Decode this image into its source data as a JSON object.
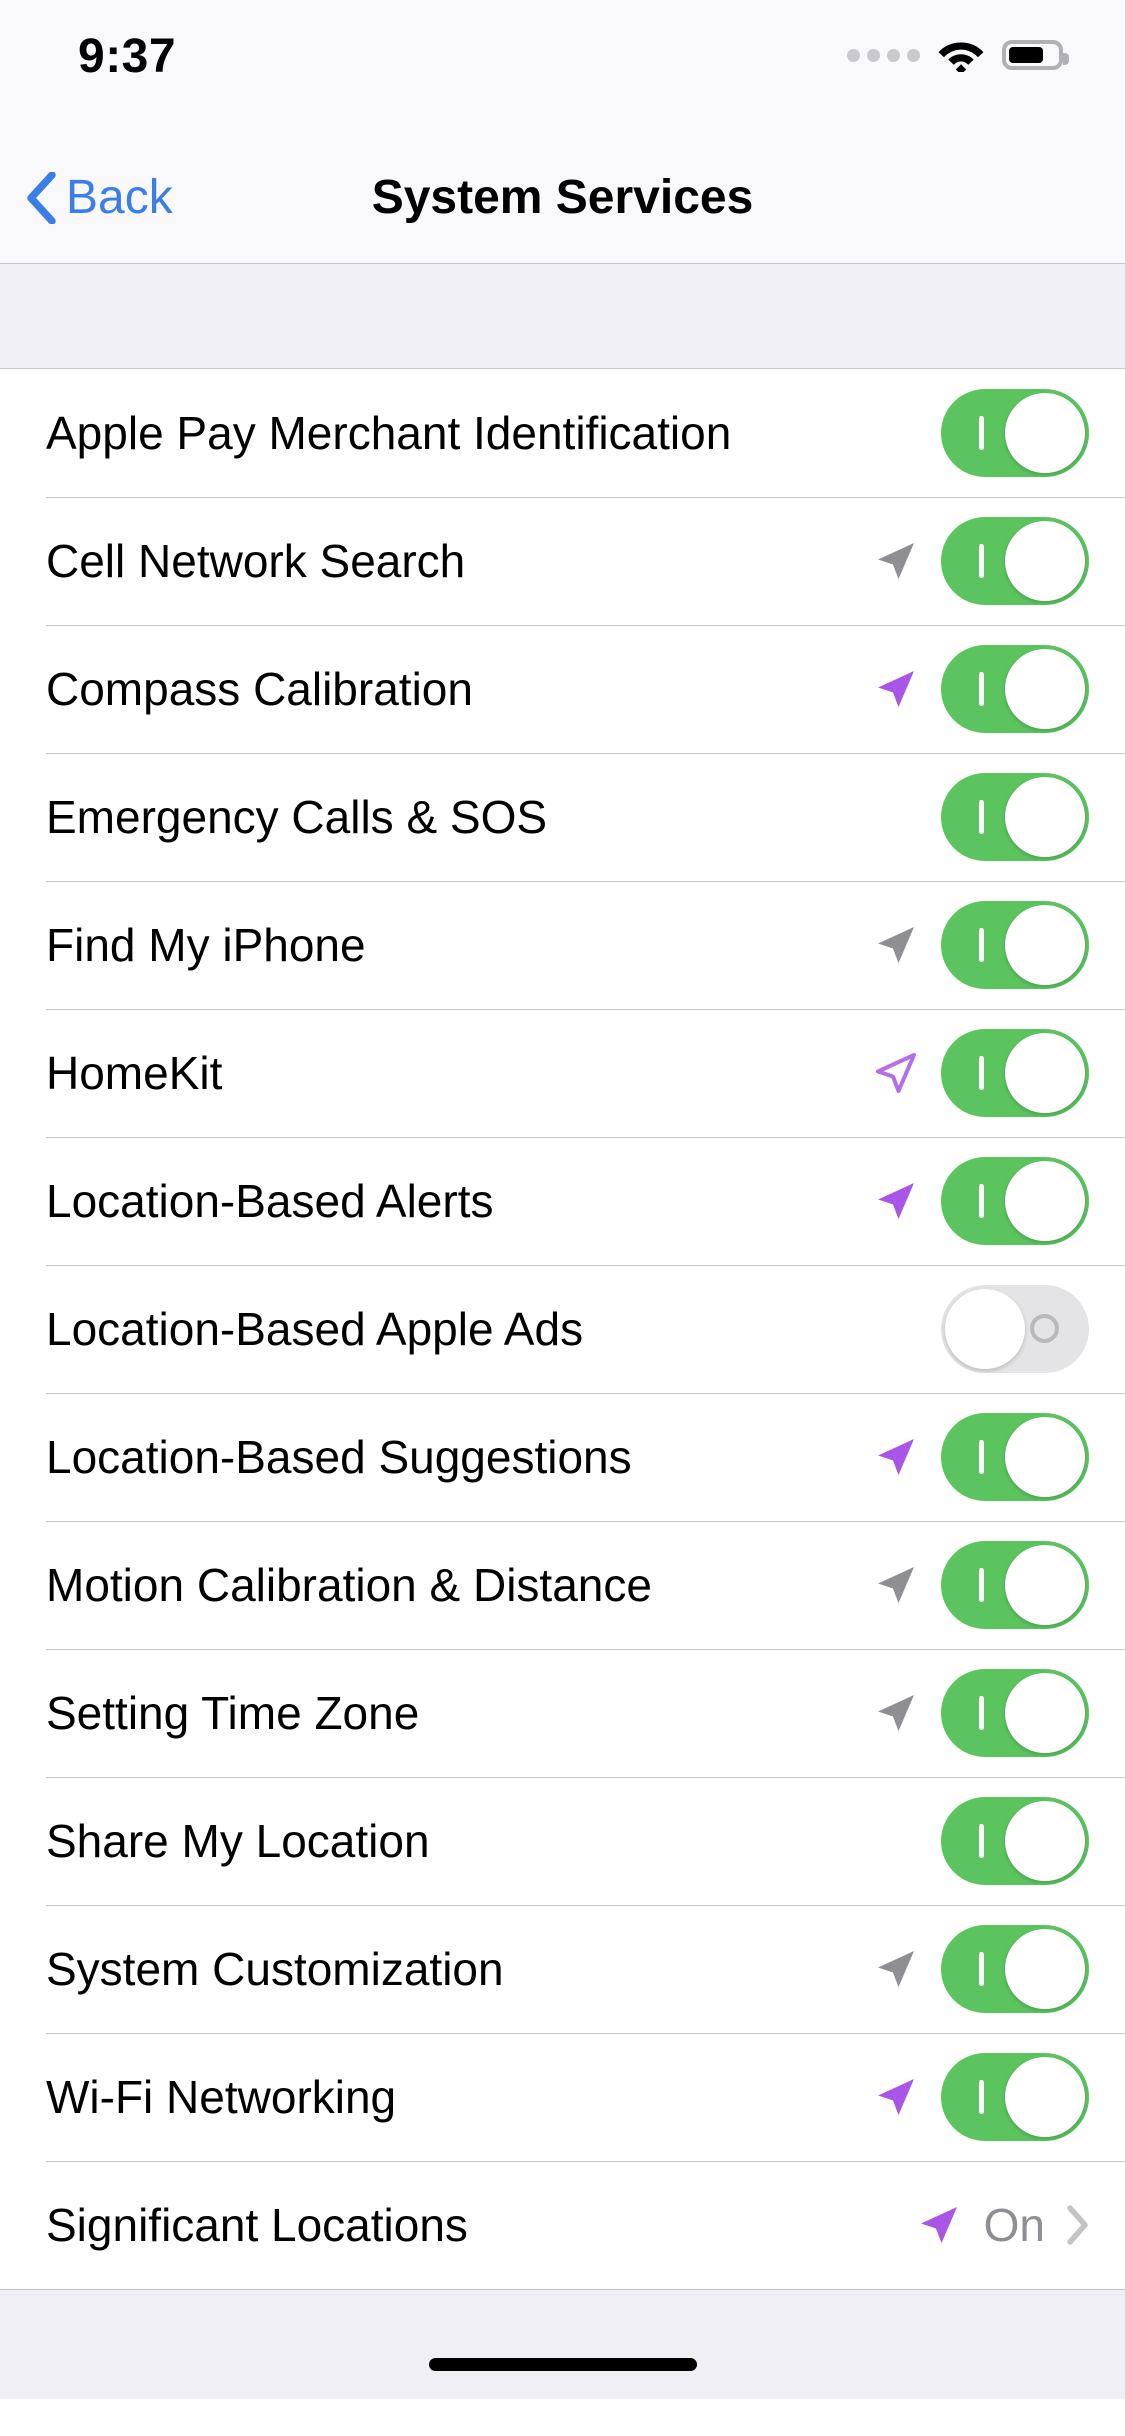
{
  "status_bar": {
    "time": "9:37",
    "signal_dots": 4,
    "signal_icon": "cellular-dots-icon",
    "wifi_icon": "wifi-icon",
    "battery_icon": "battery-icon",
    "battery_level_percent": 72
  },
  "nav_bar": {
    "back_label": "Back",
    "back_icon": "chevron-left-icon",
    "title": "System Services",
    "accent_color": "#3b7ee5"
  },
  "colors": {
    "toggle_on": "#5cc45f",
    "toggle_off": "#e4e4e6",
    "arrow_purple": "#a855e8",
    "arrow_gray": "#8e8e93",
    "group_background": "#efeff4",
    "separator": "#c8c7cc",
    "secondary_text": "#8e8e93"
  },
  "list": {
    "rows": [
      {
        "label": "Apple Pay Merchant Identification",
        "arrow": "none",
        "control": "toggle",
        "value": "on"
      },
      {
        "label": "Cell Network Search",
        "arrow": "gray-filled",
        "control": "toggle",
        "value": "on"
      },
      {
        "label": "Compass Calibration",
        "arrow": "purple-filled",
        "control": "toggle",
        "value": "on"
      },
      {
        "label": "Emergency Calls & SOS",
        "arrow": "none",
        "control": "toggle",
        "value": "on"
      },
      {
        "label": "Find My iPhone",
        "arrow": "gray-filled",
        "control": "toggle",
        "value": "on"
      },
      {
        "label": "HomeKit",
        "arrow": "purple-hollow",
        "control": "toggle",
        "value": "on"
      },
      {
        "label": "Location-Based Alerts",
        "arrow": "purple-filled",
        "control": "toggle",
        "value": "on"
      },
      {
        "label": "Location-Based Apple Ads",
        "arrow": "none",
        "control": "toggle",
        "value": "off"
      },
      {
        "label": "Location-Based Suggestions",
        "arrow": "purple-filled",
        "control": "toggle",
        "value": "on"
      },
      {
        "label": "Motion Calibration & Distance",
        "arrow": "gray-filled",
        "control": "toggle",
        "value": "on"
      },
      {
        "label": "Setting Time Zone",
        "arrow": "gray-filled",
        "control": "toggle",
        "value": "on"
      },
      {
        "label": "Share My Location",
        "arrow": "none",
        "control": "toggle",
        "value": "on"
      },
      {
        "label": "System Customization",
        "arrow": "gray-filled",
        "control": "toggle",
        "value": "on"
      },
      {
        "label": "Wi-Fi Networking",
        "arrow": "purple-filled",
        "control": "toggle",
        "value": "on"
      },
      {
        "label": "Significant Locations",
        "arrow": "purple-filled",
        "control": "detail",
        "value": "On",
        "disclosure_icon": "chevron-right-icon"
      }
    ]
  },
  "home_indicator": {
    "name": "home-indicator"
  }
}
